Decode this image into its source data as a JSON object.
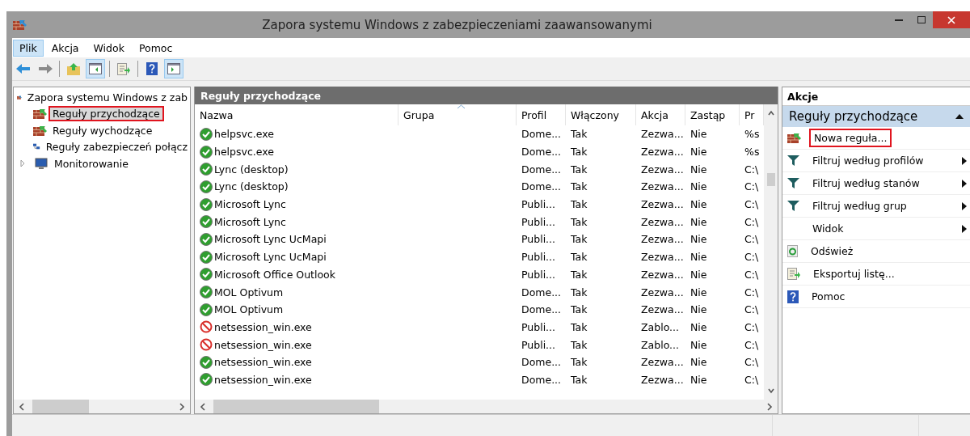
{
  "window": {
    "title": "Zapora systemu Windows z zabezpieczeniami zaawansowanymi"
  },
  "menu": [
    {
      "label": "Plik",
      "selected": true
    },
    {
      "label": "Akcja",
      "selected": false
    },
    {
      "label": "Widok",
      "selected": false
    },
    {
      "label": "Pomoc",
      "selected": false
    }
  ],
  "toolbar": [
    {
      "kind": "back",
      "pressed": false
    },
    {
      "kind": "forward",
      "pressed": false
    },
    {
      "kind": "sep"
    },
    {
      "kind": "up",
      "pressed": false
    },
    {
      "kind": "tree",
      "pressed": true
    },
    {
      "kind": "sep"
    },
    {
      "kind": "export",
      "pressed": false
    },
    {
      "kind": "sep"
    },
    {
      "kind": "help",
      "pressed": false
    },
    {
      "kind": "panel",
      "pressed": true
    }
  ],
  "tree": {
    "label": "Zapora systemu Windows z zab",
    "children": [
      {
        "label": "Reguły przychodzące",
        "selected": true,
        "highlighted": true,
        "kind": "inbound"
      },
      {
        "label": "Reguły wychodzące",
        "selected": false,
        "highlighted": false,
        "kind": "outbound"
      },
      {
        "label": "Reguły zabezpieczeń połącz",
        "selected": false,
        "highlighted": false,
        "kind": "security"
      },
      {
        "label": "Monitorowanie",
        "selected": false,
        "highlighted": false,
        "kind": "monitor",
        "expanded": false
      }
    ]
  },
  "table": {
    "title": "Reguły przychodzące",
    "columns": [
      {
        "label": "Nazwa",
        "sorted": false
      },
      {
        "label": "Grupa",
        "sorted": true
      },
      {
        "label": "Profil",
        "sorted": false
      },
      {
        "label": "Włączony",
        "sorted": false
      },
      {
        "label": "Akcja",
        "sorted": false
      },
      {
        "label": "Zastąp",
        "sorted": false
      },
      {
        "label": "Pr",
        "sorted": false
      }
    ],
    "rows": [
      {
        "kind": "allow",
        "cells": [
          "helpsvc.exe",
          "",
          "Dome...",
          "Tak",
          "Zezwa...",
          "Nie",
          "%s"
        ]
      },
      {
        "kind": "allow",
        "cells": [
          "helpsvc.exe",
          "",
          "Dome...",
          "Tak",
          "Zezwa...",
          "Nie",
          "%s"
        ]
      },
      {
        "kind": "allow",
        "cells": [
          "Lync (desktop)",
          "",
          "Dome...",
          "Tak",
          "Zezwa...",
          "Nie",
          "C:\\"
        ]
      },
      {
        "kind": "allow",
        "cells": [
          "Lync (desktop)",
          "",
          "Dome...",
          "Tak",
          "Zezwa...",
          "Nie",
          "C:\\"
        ]
      },
      {
        "kind": "allow",
        "cells": [
          "Microsoft Lync",
          "",
          "Publi...",
          "Tak",
          "Zezwa...",
          "Nie",
          "C:\\"
        ]
      },
      {
        "kind": "allow",
        "cells": [
          "Microsoft Lync",
          "",
          "Publi...",
          "Tak",
          "Zezwa...",
          "Nie",
          "C:\\"
        ]
      },
      {
        "kind": "allow",
        "cells": [
          "Microsoft Lync UcMapi",
          "",
          "Publi...",
          "Tak",
          "Zezwa...",
          "Nie",
          "C:\\"
        ]
      },
      {
        "kind": "allow",
        "cells": [
          "Microsoft Lync UcMapi",
          "",
          "Publi...",
          "Tak",
          "Zezwa...",
          "Nie",
          "C:\\"
        ]
      },
      {
        "kind": "allow",
        "cells": [
          "Microsoft Office Outlook",
          "",
          "Publi...",
          "Tak",
          "Zezwa...",
          "Nie",
          "C:\\"
        ]
      },
      {
        "kind": "allow",
        "cells": [
          "MOL Optivum",
          "",
          "Dome...",
          "Tak",
          "Zezwa...",
          "Nie",
          "C:\\"
        ]
      },
      {
        "kind": "allow",
        "cells": [
          "MOL Optivum",
          "",
          "Dome...",
          "Tak",
          "Zezwa...",
          "Nie",
          "C:\\"
        ]
      },
      {
        "kind": "block",
        "cells": [
          "netsession_win.exe",
          "",
          "Publi...",
          "Tak",
          "Zablo...",
          "Nie",
          "C:\\"
        ]
      },
      {
        "kind": "block",
        "cells": [
          "netsession_win.exe",
          "",
          "Publi...",
          "Tak",
          "Zablo...",
          "Nie",
          "C:\\"
        ]
      },
      {
        "kind": "allow",
        "cells": [
          "netsession_win.exe",
          "",
          "Dome...",
          "Tak",
          "Zezwa...",
          "Nie",
          "C:\\"
        ]
      },
      {
        "kind": "allow",
        "cells": [
          "netsession_win.exe",
          "",
          "Dome...",
          "Tak",
          "Zezwa...",
          "Nie",
          "C:\\"
        ]
      }
    ]
  },
  "actions": {
    "title": "Akcje",
    "section": "Reguły przychodzące",
    "items": [
      {
        "kind": "new",
        "label": "Nowa reguła...",
        "highlighted": true,
        "submenu": false
      },
      {
        "kind": "filter",
        "label": "Filtruj według profilów",
        "highlighted": false,
        "submenu": true
      },
      {
        "kind": "filter",
        "label": "Filtruj według stanów",
        "highlighted": false,
        "submenu": true
      },
      {
        "kind": "filter",
        "label": "Filtruj według grup",
        "highlighted": false,
        "submenu": true
      },
      {
        "kind": "none",
        "label": "Widok",
        "highlighted": false,
        "submenu": true
      },
      {
        "kind": "refresh",
        "label": "Odśwież",
        "highlighted": false,
        "submenu": false
      },
      {
        "kind": "export",
        "label": "Eksportuj listę...",
        "highlighted": false,
        "submenu": false
      },
      {
        "kind": "help",
        "label": "Pomoc",
        "highlighted": false,
        "submenu": false
      }
    ]
  }
}
